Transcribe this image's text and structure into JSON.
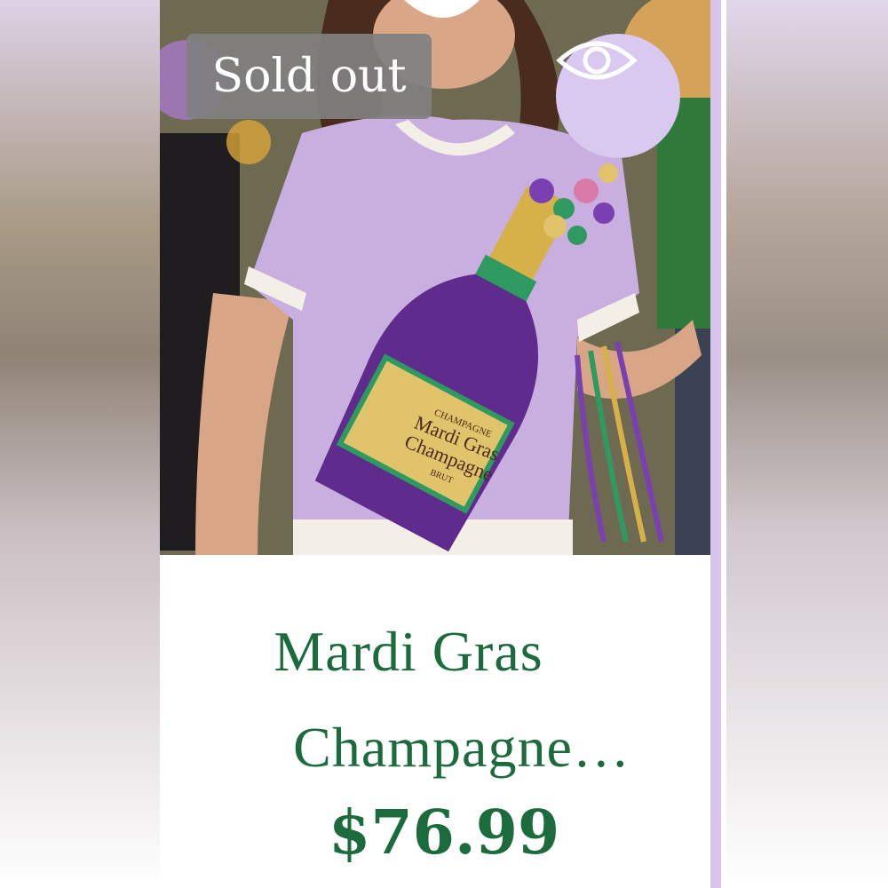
{
  "product": {
    "badge": "Sold out",
    "title_line1": "Mardi Gras",
    "title_line2": "Champagne…",
    "price": "$76.99",
    "view_icon": "eye-icon",
    "label_text": {
      "top": "CHAMPAGNE",
      "name1": "Mardi Gras",
      "name2": "Champagne",
      "bottom": "BRUT"
    }
  },
  "colors": {
    "title_green": "#1c6b3d",
    "badge_gray": "#808080",
    "eye_circle": "#d9c8f0",
    "shirt_lavender": "#c9aee0",
    "accent_stripe": "#d7c6ea"
  }
}
